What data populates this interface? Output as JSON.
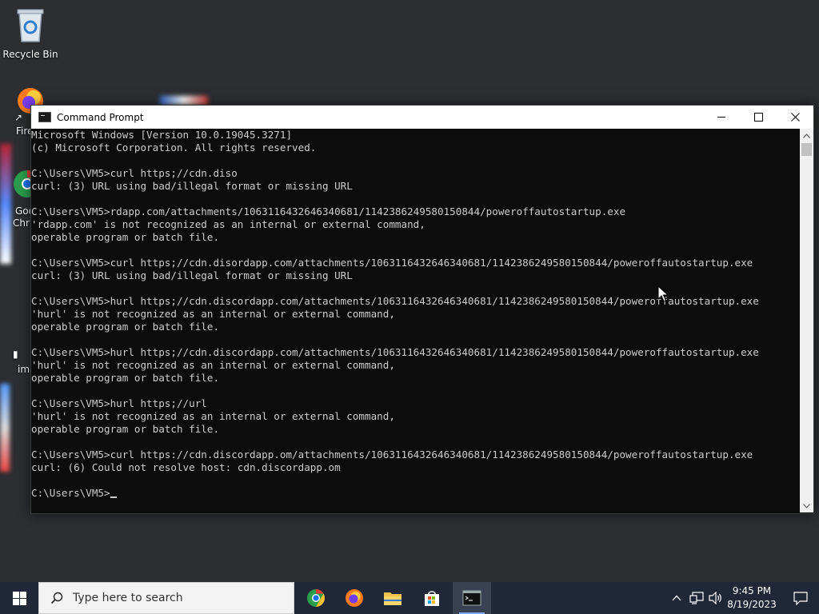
{
  "desktop": {
    "recycle_bin_label": "Recycle Bin",
    "partial_labels": [
      "Fire",
      "Goo",
      "Chr",
      "ima"
    ]
  },
  "window": {
    "title": "Command Prompt",
    "controls": {
      "minimize": "minimize",
      "maximize": "maximize",
      "close": "close"
    }
  },
  "console": {
    "lines": [
      "Microsoft Windows [Version 10.0.19045.3271]",
      "(c) Microsoft Corporation. All rights reserved.",
      "",
      "C:\\Users\\VM5>curl https;//cdn.diso",
      "curl: (3) URL using bad/illegal format or missing URL",
      "",
      "C:\\Users\\VM5>rdapp.com/attachments/1063116432646340681/1142386249580150844/poweroffautostartup.exe",
      "'rdapp.com' is not recognized as an internal or external command,",
      "operable program or batch file.",
      "",
      "C:\\Users\\VM5>curl https;//cdn.disordapp.com/attachments/1063116432646340681/1142386249580150844/poweroffautostartup.exe",
      "curl: (3) URL using bad/illegal format or missing URL",
      "",
      "C:\\Users\\VM5>hurl https;//cdn.discordapp.com/attachments/1063116432646340681/1142386249580150844/poweroffautostartup.exe",
      "'hurl' is not recognized as an internal or external command,",
      "operable program or batch file.",
      "",
      "C:\\Users\\VM5>hurl https;//cdn.discordapp.com/attachments/1063116432646340681/1142386249580150844/poweroffautostartup.exe",
      "'hurl' is not recognized as an internal or external command,",
      "operable program or batch file.",
      "",
      "C:\\Users\\VM5>hurl https;//url",
      "'hurl' is not recognized as an internal or external command,",
      "operable program or batch file.",
      "",
      "C:\\Users\\VM5>curl https://cdn.discordapp.om/attachments/1063116432646340681/1142386249580150844/poweroffautostartup.exe",
      "curl: (6) Could not resolve host: cdn.discordapp.om",
      ""
    ],
    "prompt": "C:\\Users\\VM5>"
  },
  "taskbar": {
    "search_placeholder": "Type here to search",
    "apps": [
      {
        "name": "chrome-icon"
      },
      {
        "name": "firefox-icon"
      },
      {
        "name": "file-explorer-icon"
      },
      {
        "name": "store-icon"
      },
      {
        "name": "command-prompt-icon",
        "active": true
      }
    ],
    "clock": {
      "time": "9:45 PM",
      "date": "8/19/2023"
    }
  },
  "colors": {
    "console_bg": "#0c0c0c",
    "console_fg": "#cccccc",
    "desktop_bg": "#2c2e32",
    "taskbar_bg": "#202838"
  }
}
